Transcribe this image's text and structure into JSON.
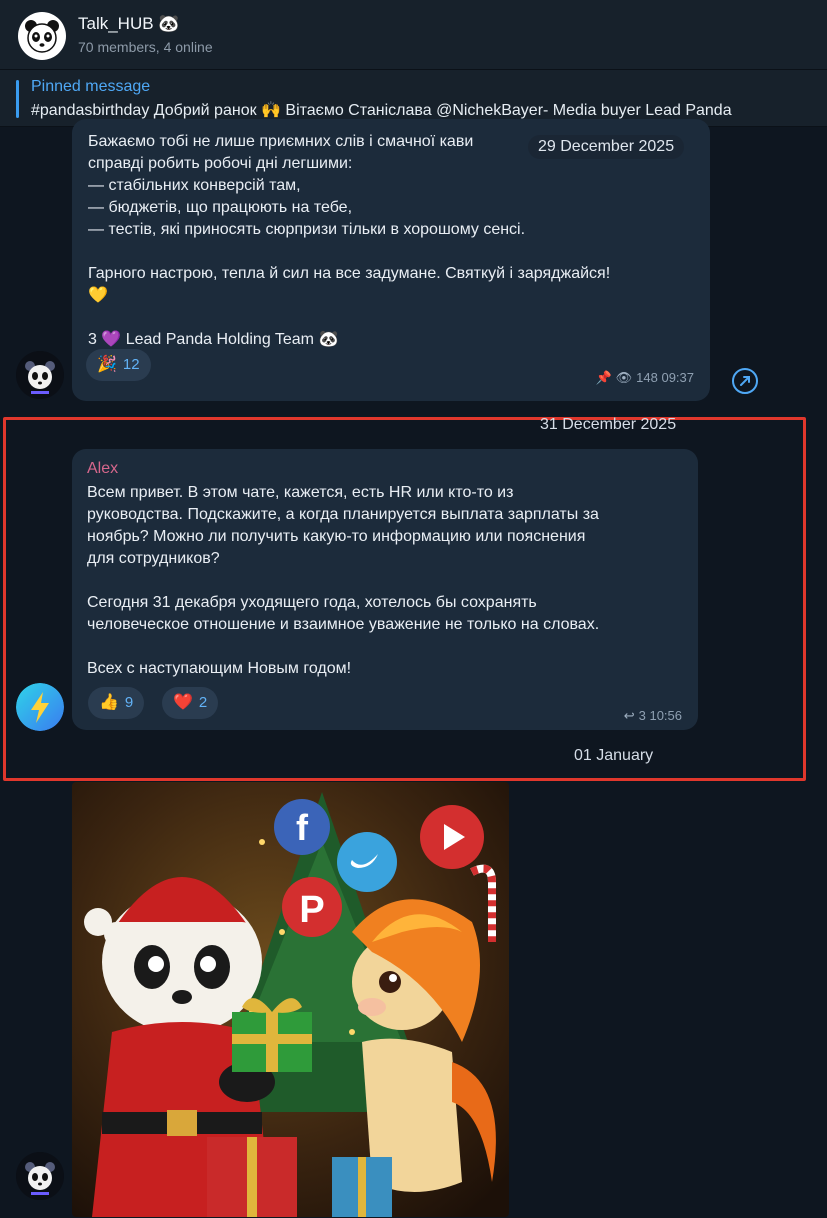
{
  "header": {
    "title": "Talk_HUB 🐼",
    "subtitle": "70 members, 4 online"
  },
  "pinned": {
    "label": "Pinned message",
    "text": "#pandasbirthday  Добрий ранок 🙌 Вітаємо Станіслава @NichekBayer- Media buyer  Lead Panda"
  },
  "messages": [
    {
      "date_label": "29 December 2025",
      "text": "Бажаємо тобі не лише приємних слів і смачної кави\nсправді робить робочі дні легшими:\n— стабільних конверсій там,\n— бюджетів, що працюють на тебе,\n— тестів, які приносять сюрпризи тільки в хорошому сенсі.\n\nГарного настрою, тепла й сил на все задумане. Святкуй і заряджайся!\n💛\n\n3 💜 Lead Panda Holding Team 🐼",
      "reaction_emoji": "🎉",
      "reaction_count": "12",
      "views_time": "148 09:37"
    },
    {
      "date_label": "31 December 2025",
      "sender": "Alex",
      "text": "Всем привет. В этом чате, кажется, есть HR или кто-то из\nруководства. Подскажите, а когда планируется выплата зарплаты за\nноябрь? Можно ли получить какую-то информацию или пояснения\nдля сотрудников?\n\nСегодня 31 декабря уходящего года, хотелось бы сохранять\nчеловеческое отношение и взаимное уважение не только на словах.\n\nВсех с наступающим Новым годом!",
      "reactions": [
        {
          "emoji": "👍",
          "count": "9"
        },
        {
          "emoji": "❤️",
          "count": "2"
        }
      ],
      "replies_time": "3 10:56"
    },
    {
      "date_label": "01 January"
    }
  ],
  "colors": {
    "accent": "#4fa8f5",
    "bubble": "#1c2b3b",
    "highlight_border": "#e0372c",
    "sender_name": "#d6678c"
  }
}
